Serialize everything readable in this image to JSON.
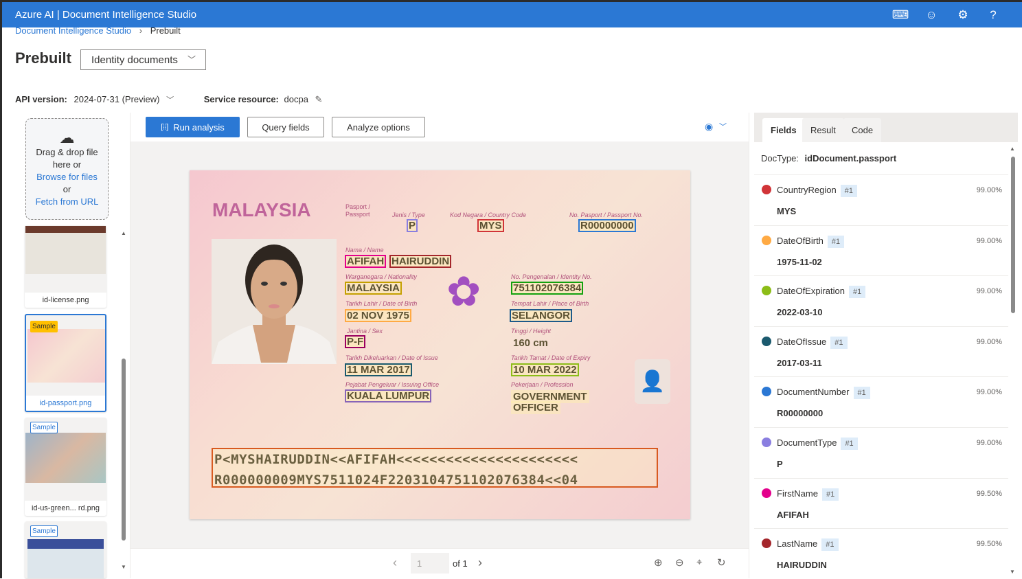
{
  "header": {
    "title": "Azure AI | Document Intelligence Studio",
    "icons": [
      "keyboard-icon",
      "feedback-smiley-icon",
      "settings-gear-icon",
      "help-icon"
    ]
  },
  "breadcrumb": {
    "root": "Document Intelligence Studio",
    "current": "Prebuilt"
  },
  "page": {
    "title": "Prebuilt",
    "model_select": "Identity documents"
  },
  "api": {
    "label": "API version:",
    "value": "2024-07-31 (Preview)",
    "resource_label": "Service resource:",
    "resource_value": "docpa"
  },
  "upload": {
    "line1": "Drag & drop file",
    "line2": "here or",
    "browse": "Browse for files",
    "or": "or",
    "fetch": "Fetch from URL"
  },
  "thumbnails": [
    {
      "name": "id-license.png",
      "badge": ""
    },
    {
      "name": "id-passport.png",
      "badge": "Sample",
      "selected": true
    },
    {
      "name": "id-us-green... rd.png",
      "badge": "Sample"
    },
    {
      "name": "",
      "badge": "Sample"
    }
  ],
  "toolbar": {
    "run": "Run analysis",
    "query": "Query fields",
    "options": "Analyze options"
  },
  "pager": {
    "page": "1",
    "of": "of 1"
  },
  "passport": {
    "country": "MALAYSIA",
    "doc_label": "Pasport /",
    "doc_label2": "Passport",
    "labels": [
      "Jenis / Type",
      "Kod Negara / Country Code",
      "No. Pasport / Passport No.",
      "Nama / Name",
      "Warganegara / Nationality",
      "No. Pengenalan / Identity No.",
      "Tarikh Lahir / Date of Birth",
      "Tempat Lahir / Place of Birth",
      "Jantina / Sex",
      "Tinggi / Height",
      "Tarikh Dikeluarkan / Date of Issue",
      "Tarikh Tamat / Date of Expiry",
      "Pejabat Pengeluar / Issuing Office",
      "Pekerjaan / Profession"
    ],
    "values": [
      "P",
      "MYS",
      "R00000000",
      "AFIFAH",
      "HAIRUDDIN",
      "MALAYSIA",
      "751102076384",
      "02 NOV 1975",
      "SELANGOR",
      "P-F",
      "160 cm",
      "11 MAR 2017",
      "10 MAR 2022",
      "KUALA LUMPUR",
      "GOVERNMENT",
      "OFFICER"
    ],
    "mrz1": "P<MYSHAIRUDDIN<<AFIFAH<<<<<<<<<<<<<<<<<<<<<<",
    "mrz2": "R000000009MYS7511024F2203104751102076384<<04"
  },
  "right": {
    "tabs": [
      "Fields",
      "Result",
      "Code"
    ],
    "doctype_label": "DocType:",
    "doctype": "idDocument.passport",
    "fields": [
      {
        "name": "CountryRegion",
        "badge": "#1",
        "confidence": "99.00%",
        "value": "MYS",
        "color": "#d13438"
      },
      {
        "name": "DateOfBirth",
        "badge": "#1",
        "confidence": "99.00%",
        "value": "1975-11-02",
        "color": "#ffaa44"
      },
      {
        "name": "DateOfExpiration",
        "badge": "#1",
        "confidence": "99.00%",
        "value": "2022-03-10",
        "color": "#8cbd18"
      },
      {
        "name": "DateOfIssue",
        "badge": "#1",
        "confidence": "99.00%",
        "value": "2017-03-11",
        "color": "#1b5a6e"
      },
      {
        "name": "DocumentNumber",
        "badge": "#1",
        "confidence": "99.00%",
        "value": "R00000000",
        "color": "#2b78d4"
      },
      {
        "name": "DocumentType",
        "badge": "#1",
        "confidence": "99.00%",
        "value": "P",
        "color": "#8a7ee0"
      },
      {
        "name": "FirstName",
        "badge": "#1",
        "confidence": "99.50%",
        "value": "AFIFAH",
        "color": "#e3008c"
      },
      {
        "name": "LastName",
        "badge": "#1",
        "confidence": "99.50%",
        "value": "HAIRUDDIN",
        "color": "#a4262c"
      }
    ]
  }
}
